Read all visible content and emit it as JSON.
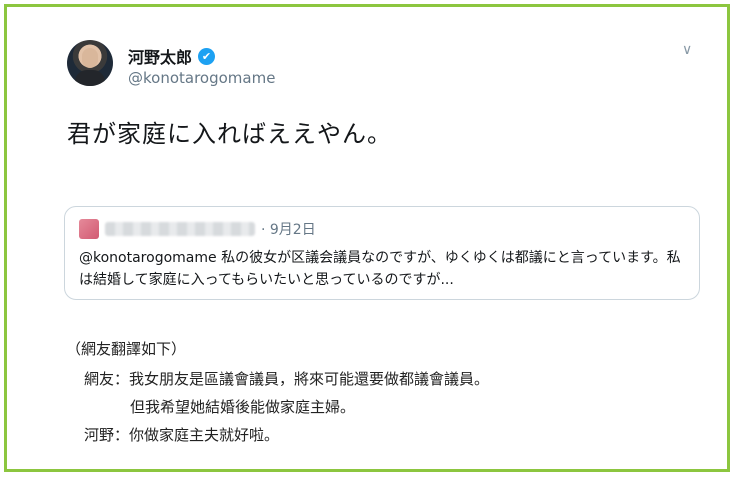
{
  "tweet": {
    "author_name": "河野太郎",
    "verified_mark": "✔",
    "handle": "@konotarogomame",
    "menu_icon": "chevron-down-icon",
    "text": "君が家庭に入ればええやん。"
  },
  "quoted": {
    "date": "· 9月2日",
    "body": "@konotarogomame 私の彼女が区議会議員なのですが、ゆくゆくは都議にと言っています。私は結婚して家庭に入ってもらいたいと思っているのですが..."
  },
  "notes": {
    "heading": "（網友翻譯如下）",
    "line1": "網友：我女朋友是區議會議員，將來可能還要做都議會議員。",
    "line2": "但我希望她結婚後能做家庭主婦。",
    "line3": "河野：你做家庭主夫就好啦。"
  },
  "colors": {
    "frame": "#8cc63f",
    "verified": "#1da1f2",
    "secondary_text": "#657786"
  }
}
